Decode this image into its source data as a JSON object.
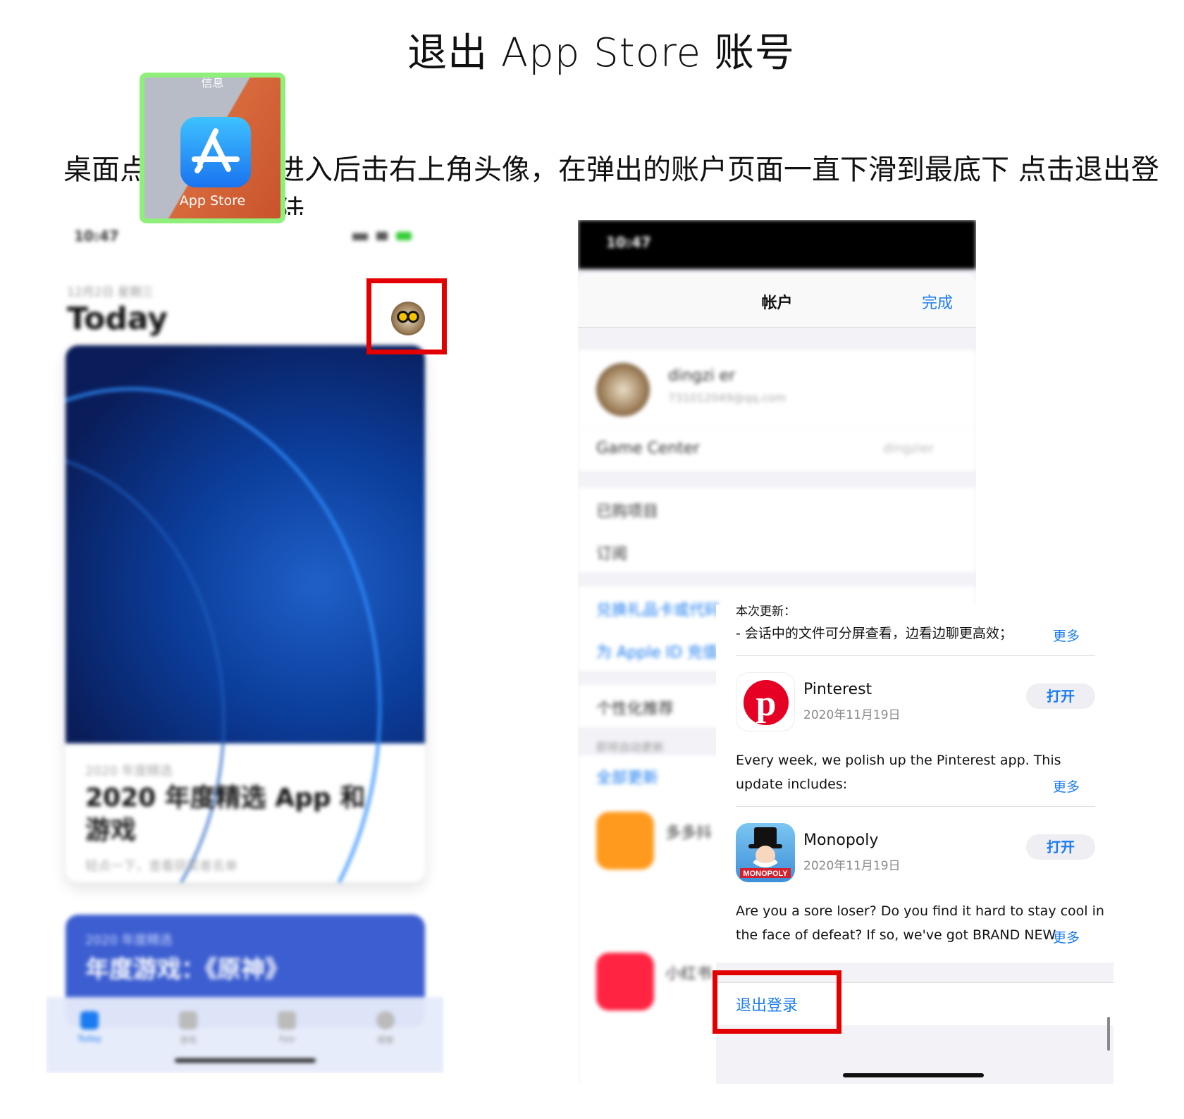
{
  "title": "退出 App Store 账号",
  "instruction": {
    "before_icon": "桌面点击",
    "after_icon": "进入后击右上角头像，在弹出的账户页面一直下滑到最底下 点击退出登陆"
  },
  "app_tile": {
    "top_label": "信息",
    "label": "App Store"
  },
  "left_phone": {
    "time": "10:47",
    "date": "12月2日 星期三",
    "heading": "Today",
    "card1": {
      "subtitle": "2020 年度精选",
      "title": "2020 年度精选 App 和游戏",
      "footer": "轻点一下，查看获奖者名单"
    },
    "card2": {
      "subtitle": "2020 年度精选",
      "title": "年度游戏：《原神》"
    },
    "tabs": [
      "Today",
      "游戏",
      "App",
      "搜索"
    ]
  },
  "right_phone": {
    "time": "10:47",
    "sheet_title": "帐户",
    "done": "完成",
    "profile_name": "dingzi er",
    "profile_email": "731012049@qq.com",
    "game_center_label": "Game Center",
    "game_center_value": "dingzier",
    "purchased": "已购项目",
    "subscriptions": "订阅",
    "redeem": "兑换礼品卡或代码",
    "add_funds": "为 Apple ID 充值",
    "recommendations": "个性化推荐",
    "recent_updates": "即将自动更新",
    "update_all": "全部更新",
    "upd_app1_name": "多多抖",
    "upd_app2_name": "小红书"
  },
  "updates_panel": {
    "prev_notes_head": "本次更新：",
    "prev_notes_line": "- 会话中的文件可分屏查看，边看边聊更高效；",
    "more": "更多",
    "apps": [
      {
        "name": "Pinterest",
        "date": "2020年11月19日",
        "open": "打开",
        "notes_1": "Every week, we polish up the Pinterest app. This",
        "notes_2": "update includes:"
      },
      {
        "name": "Monopoly",
        "date": "2020年11月19日",
        "open": "打开",
        "notes_1": "Are you a sore loser? Do you find it hard to stay cool in",
        "notes_2": "the face of defeat? If so, we've got BRAND NEW"
      }
    ],
    "logout": "退出登录"
  },
  "colors": {
    "accent_blue": "#1a7cf0",
    "highlight_red": "#e30000",
    "highlight_green": "#8ef07a"
  }
}
